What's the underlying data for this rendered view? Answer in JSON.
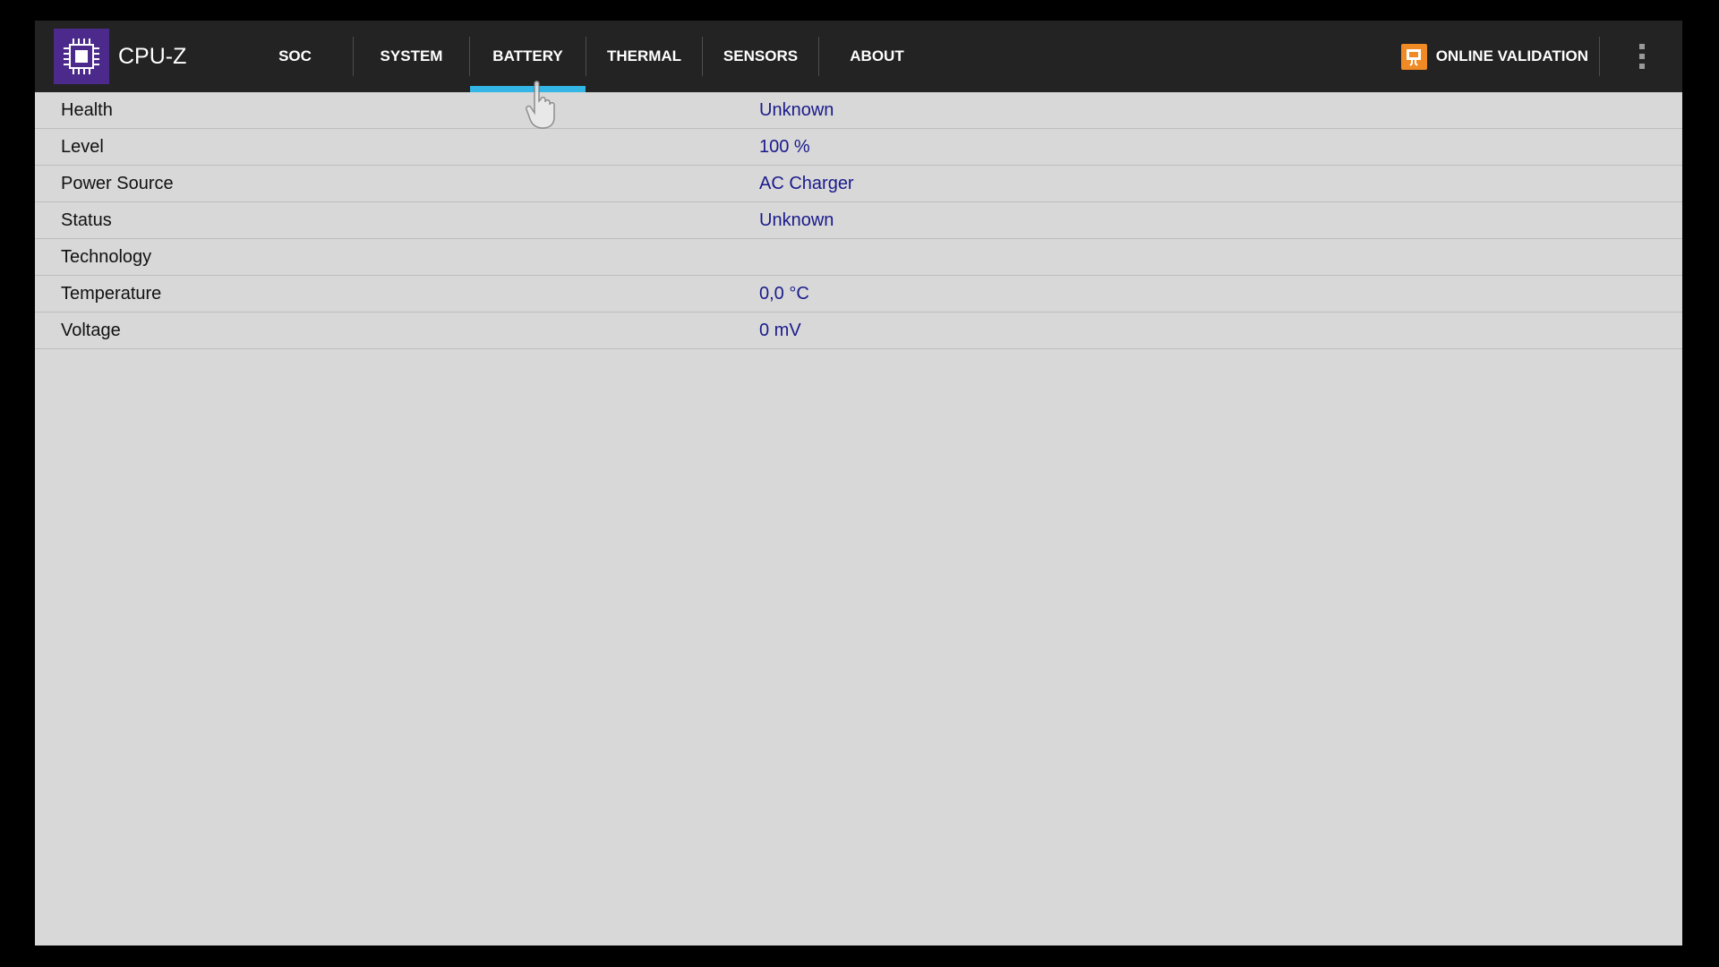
{
  "app": {
    "title": "CPU-Z",
    "logo_icon": "cpu-chip-icon"
  },
  "tabs": [
    {
      "label": "SOC",
      "active": false
    },
    {
      "label": "SYSTEM",
      "active": false
    },
    {
      "label": "BATTERY",
      "active": true
    },
    {
      "label": "THERMAL",
      "active": false
    },
    {
      "label": "SENSORS",
      "active": false
    },
    {
      "label": "ABOUT",
      "active": false
    }
  ],
  "actions": {
    "validation_label": "ONLINE VALIDATION",
    "validation_icon": "validation-icon",
    "overflow_icon": "more-vertical-icon"
  },
  "battery": {
    "rows": [
      {
        "label": "Health",
        "value": "Unknown"
      },
      {
        "label": "Level",
        "value": "100 %"
      },
      {
        "label": "Power Source",
        "value": "AC Charger"
      },
      {
        "label": "Status",
        "value": "Unknown"
      },
      {
        "label": "Technology",
        "value": ""
      },
      {
        "label": "Temperature",
        "value": "0,0 °C"
      },
      {
        "label": "Voltage",
        "value": "0 mV"
      }
    ]
  },
  "colors": {
    "actionbar": "#232323",
    "tab_indicator": "#33b5e5",
    "logo_bg": "#4b2a8c",
    "validation_accent": "#f08a24",
    "value_text": "#1a1a8c",
    "content_bg": "#d8d8d8"
  }
}
